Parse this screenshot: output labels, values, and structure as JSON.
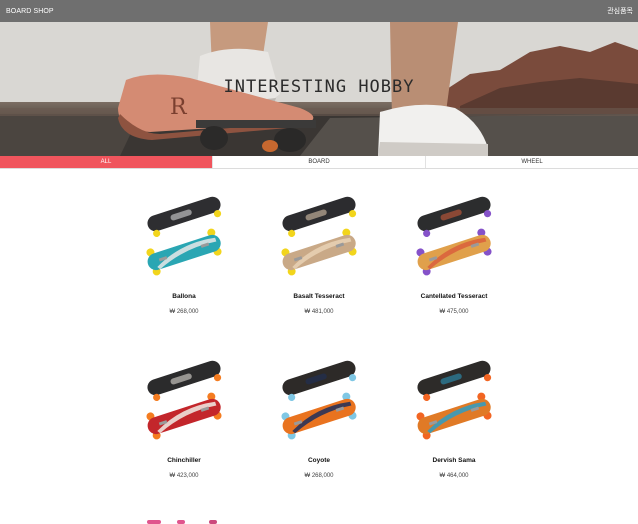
{
  "header": {
    "brand": "BOARD SHOP",
    "wishlist": "관심품목"
  },
  "hero": {
    "title": "INTERESTING HOBBY"
  },
  "tabs": [
    {
      "label": "ALL",
      "active": true
    },
    {
      "label": "BOARD",
      "active": false
    },
    {
      "label": "WHEEL",
      "active": false
    }
  ],
  "colors": {
    "accent": "#f0555d",
    "header_bg": "#6f6f6f"
  },
  "products": [
    {
      "name": "Ballona",
      "price": "₩ 268,000",
      "deck_top": "#2e2e31",
      "deck_bottom": "#2aa6b3",
      "wheel": "#f2d51c",
      "accent": "#e8e8e8"
    },
    {
      "name": "Basalt Tesseract",
      "price": "₩ 481,000",
      "deck_top": "#2c2c2f",
      "deck_bottom": "#c9a987",
      "wheel": "#f2d51c",
      "accent": "#e9d2b5"
    },
    {
      "name": "Cantellated Tesseract",
      "price": "₩ 475,000",
      "deck_top": "#2c2d2e",
      "deck_bottom": "#e0a04b",
      "wheel": "#8552c9",
      "accent": "#d95f3c"
    },
    {
      "name": "Chinchiller",
      "price": "₩ 423,000",
      "deck_top": "#2b2b2c",
      "deck_bottom": "#c3262b",
      "wheel": "#f47c20",
      "accent": "#f1ede6"
    },
    {
      "name": "Coyote",
      "price": "₩ 268,000",
      "deck_top": "#2d2a28",
      "deck_bottom": "#e9731f",
      "wheel": "#7fc7e4",
      "accent": "#1d2f5d"
    },
    {
      "name": "Dervish Sama",
      "price": "₩ 464,000",
      "deck_top": "#2d2b29",
      "deck_bottom": "#e07a26",
      "wheel": "#f26522",
      "accent": "#2c9ec6"
    }
  ]
}
